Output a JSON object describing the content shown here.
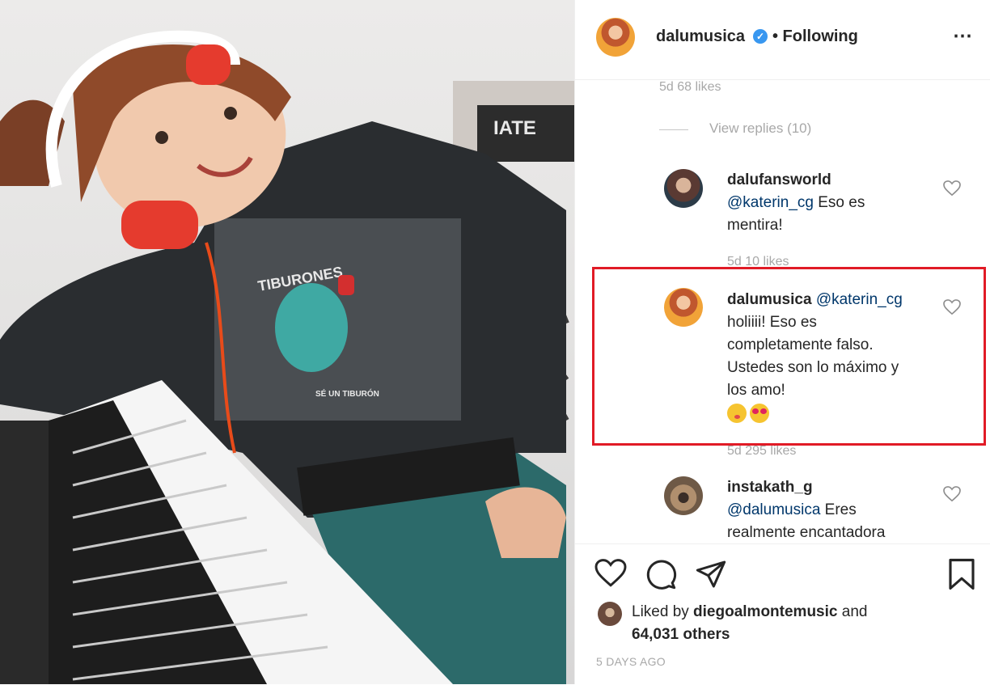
{
  "post": {
    "owner": "dalumusica",
    "follow_status": "• Following",
    "more_icon": "⋯",
    "photo_shirt_title": "TIBURONES",
    "photo_shirt_caption": "SÉ UN TIBURÓN",
    "photo_keyboard_brand": "IATE"
  },
  "comments": {
    "prev_meta": "5d   68 likes",
    "view_replies": "View replies (10)",
    "items": [
      {
        "username": "dalufansworld",
        "mention": "@katerin_cg",
        "text_1": " Eso es",
        "text_2": "mentira!",
        "meta": "5d   10 likes"
      },
      {
        "username": "dalumusica",
        "mention": "@katerin_cg",
        "line_1": "holiiii! Eso es",
        "line_2": "completamente falso.",
        "line_3": "Ustedes son lo máximo y",
        "line_4": "los amo!",
        "meta": "5d   295 likes"
      },
      {
        "username": "instakath_g",
        "mention": "@dalumusica",
        "text_1": " Eres",
        "text_2": "realmente encantadora"
      }
    ]
  },
  "footer": {
    "liked_prefix": "Liked by ",
    "liked_user": "diegoalmontemusic",
    "liked_and": " and",
    "liked_others": "64,031 others",
    "date": "5 DAYS AGO"
  }
}
